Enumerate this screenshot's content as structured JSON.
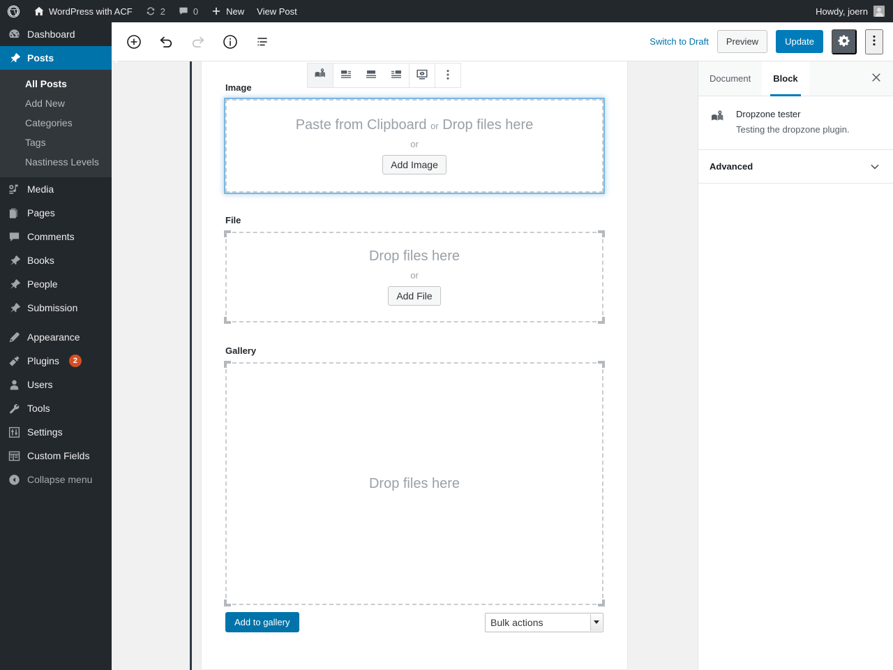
{
  "adminbar": {
    "logo_icon": "wordpress-logo-icon",
    "site_icon": "home-icon",
    "site_name": "WordPress with ACF",
    "updates_icon": "updates-icon",
    "updates_count": "2",
    "comments_icon": "comment-bubble-icon",
    "comments_count": "0",
    "new_icon": "plus-icon",
    "new_label": "New",
    "view_post_label": "View Post",
    "howdy": "Howdy, joern",
    "avatar_name": "avatar"
  },
  "sidebar": {
    "items": [
      {
        "label": "Dashboard",
        "icon": "dashboard-icon",
        "current": false
      },
      {
        "label": "Posts",
        "icon": "pin-icon",
        "current": true
      },
      {
        "label": "Media",
        "icon": "media-icon",
        "current": false
      },
      {
        "label": "Pages",
        "icon": "pages-icon",
        "current": false
      },
      {
        "label": "Comments",
        "icon": "comment-bubble-icon",
        "current": false
      },
      {
        "label": "Books",
        "icon": "pin-icon",
        "current": false
      },
      {
        "label": "People",
        "icon": "pin-icon",
        "current": false
      },
      {
        "label": "Submission",
        "icon": "pin-icon",
        "current": false
      },
      {
        "label": "Appearance",
        "icon": "brush-icon",
        "current": false
      },
      {
        "label": "Plugins",
        "icon": "plug-icon",
        "current": false,
        "badge": "2"
      },
      {
        "label": "Users",
        "icon": "user-icon",
        "current": false
      },
      {
        "label": "Tools",
        "icon": "wrench-icon",
        "current": false
      },
      {
        "label": "Settings",
        "icon": "settings-sliders-icon",
        "current": false
      },
      {
        "label": "Custom Fields",
        "icon": "custom-fields-icon",
        "current": false
      },
      {
        "label": "Collapse menu",
        "icon": "collapse-arrow-icon",
        "current": false
      }
    ],
    "submenu": [
      {
        "label": "All Posts",
        "active": true
      },
      {
        "label": "Add New",
        "active": false
      },
      {
        "label": "Categories",
        "active": false
      },
      {
        "label": "Tags",
        "active": false
      },
      {
        "label": "Nastiness Levels",
        "active": false
      }
    ]
  },
  "header": {
    "add_block_icon": "plus-circle-icon",
    "undo_icon": "undo-icon",
    "redo_icon": "redo-icon",
    "info_icon": "info-circle-icon",
    "list_view_icon": "list-view-icon",
    "switch_to_draft": "Switch to Draft",
    "preview": "Preview",
    "update": "Update",
    "settings_icon": "gear-icon",
    "more_icon": "kebab-menu-icon"
  },
  "block_toolbar": {
    "block_type_icon": "dropzone-block-icon",
    "align_left_icon": "align-left-icon",
    "align_center_icon": "align-center-icon",
    "align_right_icon": "align-right-icon",
    "preview_icon": "display-preview-icon",
    "more_icon": "kebab-menu-icon"
  },
  "content": {
    "image": {
      "label": "Image",
      "message_main": "Paste from Clipboard",
      "message_or": "or",
      "message_rest": "Drop files here",
      "or": "or",
      "button": "Add Image"
    },
    "file": {
      "label": "File",
      "message": "Drop files here",
      "or": "or",
      "button": "Add File"
    },
    "gallery": {
      "label": "Gallery",
      "message": "Drop files here",
      "add_button": "Add to gallery",
      "bulk_actions_value": "Bulk actions"
    }
  },
  "rightpanel": {
    "tab_document": "Document",
    "tab_block": "Block",
    "close_icon": "close-icon",
    "block_icon": "dropzone-block-icon",
    "block_title": "Dropzone tester",
    "block_description": "Testing the dropzone plugin.",
    "advanced_label": "Advanced",
    "chevron_icon": "chevron-down-icon"
  },
  "colors": {
    "admin_dark": "#23282d",
    "submenu_dark": "#32373c",
    "accent_blue": "#0073aa",
    "primary_blue": "#007cba",
    "badge_orange": "#d54e21",
    "dropzone_border": "#c9cdd2",
    "dropzone_active": "#7bb7e0"
  }
}
